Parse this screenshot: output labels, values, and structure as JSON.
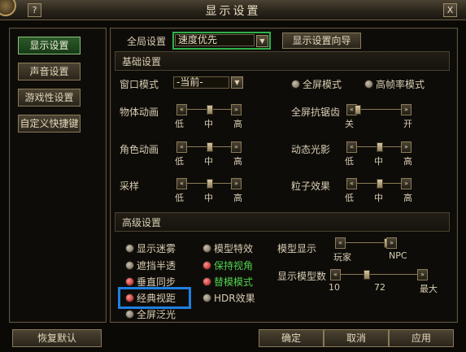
{
  "window": {
    "title": "显示设置",
    "help_label": "?",
    "close_label": "X"
  },
  "sidebar": {
    "items": [
      {
        "label": "显示设置"
      },
      {
        "label": "声音设置"
      },
      {
        "label": "游戏性设置"
      },
      {
        "label": "自定义快捷键"
      }
    ]
  },
  "global": {
    "label": "全局设置",
    "value": "速度优先",
    "wizard_label": "显示设置向导"
  },
  "basic": {
    "header": "基础设置",
    "window_mode_label": "窗口模式",
    "window_mode_value": "-当前-",
    "fullscreen_label": "全屏模式",
    "high_fps_label": "高帧率模式",
    "sliders": [
      {
        "label": "物体动画",
        "ticks": [
          "低",
          "中",
          "高"
        ],
        "value": 0.5
      },
      {
        "label": "角色动画",
        "ticks": [
          "低",
          "中",
          "高"
        ],
        "value": 0.5
      },
      {
        "label": "采样",
        "ticks": [
          "低",
          "中",
          "高"
        ],
        "value": 0.5
      },
      {
        "label": "全屏抗锯齿",
        "ticks": [
          "关",
          "开"
        ],
        "value": 0.0
      },
      {
        "label": "动态光影",
        "ticks": [
          "低",
          "中",
          "高"
        ],
        "value": 0.5
      },
      {
        "label": "粒子效果",
        "ticks": [
          "低",
          "中",
          "高"
        ],
        "value": 0.5
      }
    ]
  },
  "advanced": {
    "header": "高级设置",
    "options_col1": [
      "显示迷雾",
      "遮挡半透",
      "垂直同步",
      "经典视距",
      "全屏泛光"
    ],
    "options_col2": [
      "模型特效",
      "保持视角",
      "替模模式",
      "HDR效果"
    ],
    "model_display_label": "模型显示",
    "model_display_ticks": [
      "玩家",
      "NPC"
    ],
    "model_display_value": 1.0,
    "model_count_label": "显示模型数",
    "model_count_ticks": [
      "10",
      "72",
      "最大"
    ],
    "model_count_value": 0.33
  },
  "footer": {
    "restore_label": "恢复默认",
    "ok_label": "确定",
    "cancel_label": "取消",
    "apply_label": "应用"
  },
  "colors": {
    "highlight_green": "#2fb24a",
    "highlight_blue": "#1f7fe0",
    "green_text": "#4fd24f"
  }
}
